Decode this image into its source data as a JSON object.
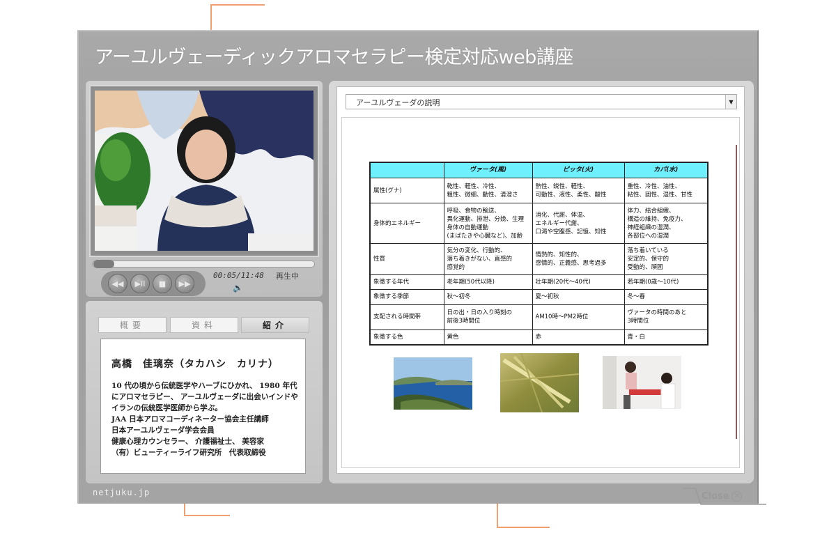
{
  "window": {
    "title": "アーユルヴェーディックアロマセラピー検定対応web講座"
  },
  "player": {
    "time": "00:05/11:48",
    "status": "再生中",
    "controls": {
      "prev": "◀◀",
      "play_pause": "▶II",
      "stop": "■",
      "next": "▶▶"
    },
    "progress_fraction": 0.007
  },
  "tabs": [
    {
      "label": "概要",
      "active": false
    },
    {
      "label": "資料",
      "active": false
    },
    {
      "label": "紹介",
      "active": true
    }
  ],
  "bio": {
    "name": "高橋　佳璃奈（タカハシ　カリナ）",
    "lines": [
      "10 代の頃から伝統医学やハーブにひかれ、 1980 年代",
      "にアロマセラピー、 アーユルヴェーダに出会いインドや",
      "イランの伝統医学医師から学ぶ。",
      "JAA 日本アロマコーディネーター協会主任講師",
      "日本アーユルヴェーダ学会会員",
      "健康心理カウンセラー、 介護福祉士、 美容家",
      "（有）ビューティーライフ研究所　代表取締役"
    ]
  },
  "brand": "netjuku.jp",
  "close_label": "Close",
  "document": {
    "selected": "アーユルヴェーダの説明",
    "table": {
      "headers": [
        "",
        "ヴァータ(風)",
        "ピッタ(火)",
        "カパ(水)"
      ],
      "rows": [
        [
          "属性(グナ)",
          "乾性、軽性、冷性、\n粗性、微細、動性、清澄さ",
          "熱性、鋭性、軽性、\n可動性、液性、柔性、酸性",
          "重性、冷性、油性、\n粘性、固性、湿性、甘性"
        ],
        [
          "身体的エネルギー",
          "呼吸、食物の輸送、\n異化運動、排泄、分娩、生理\n身体の自動運動\n(まばたきや心臓など)、加齢",
          "消化、代謝、体温、\nエネルギー代謝、\n口渇や空腹感、記憶、知性",
          "体力、結合組織、\n構造の維持、免疫力、\n神経組織の湿潤、\n各部位への湿潤"
        ],
        [
          "性質",
          "気分の変化、行動的、\n落ち着きがない、直感的\n感覚的",
          "情熱的、知性的、\n感情的、正義感、思考過多",
          "落ち着いている\n安定的、保守的\n受動的、頑固"
        ],
        [
          "象徴する年代",
          "老年期(50代以降)",
          "壮年期(20代〜40代)",
          "若年期(0歳〜10代)"
        ],
        [
          "象徴する季節",
          "秋〜初冬",
          "夏〜初秋",
          "冬〜春"
        ],
        [
          "支配される時間帯",
          "日の出・日の入り時刻の\n前後3時間位",
          "AM10時〜PM2時位",
          "ヴァータの時間のあと\n3時間位"
        ],
        [
          "象徴する色",
          "黄色",
          "赤",
          "青・白"
        ]
      ]
    }
  },
  "colors": {
    "table_header": "#6ff0ff",
    "callout": "#f0a070"
  }
}
